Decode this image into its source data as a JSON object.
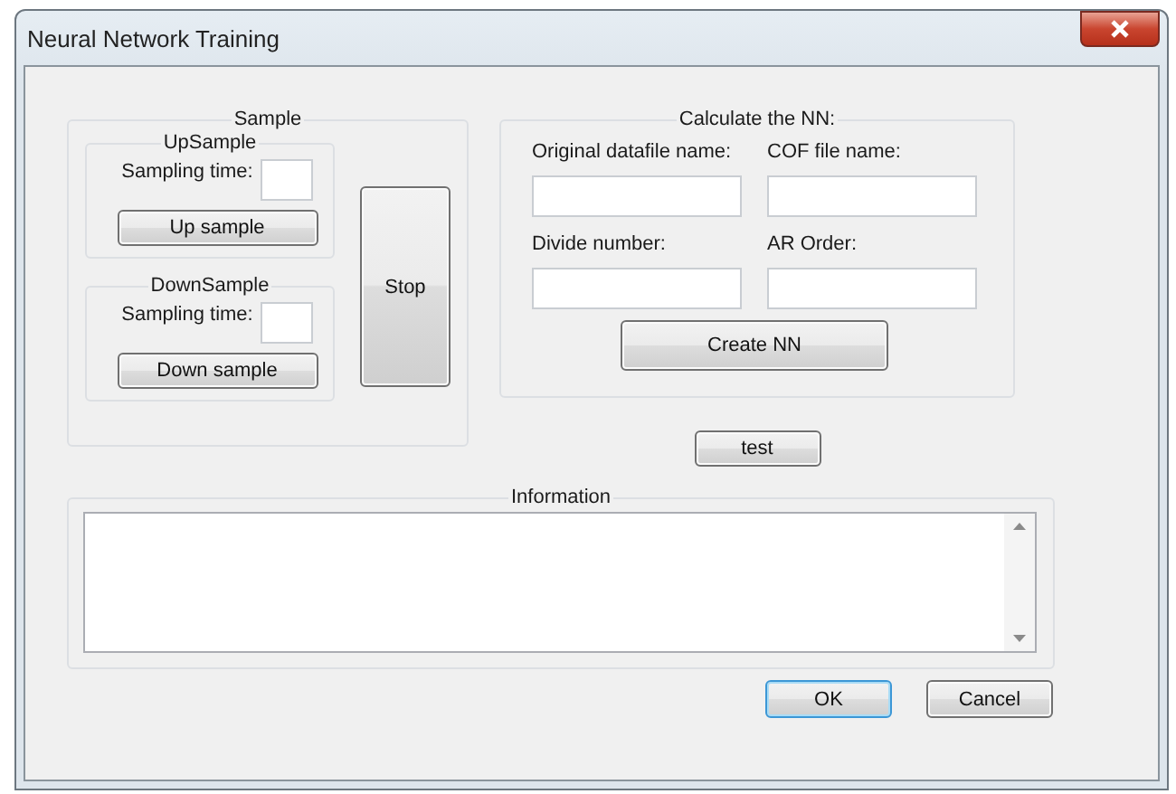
{
  "window": {
    "title": "Neural Network Training"
  },
  "sample": {
    "title": "Sample",
    "groups": [
      {
        "title": "UpSample",
        "label": "Sampling time:",
        "button": "Up sample"
      },
      {
        "title": "DownSample",
        "label": "Sampling time:",
        "button": "Down sample"
      }
    ],
    "stop_button": "Stop"
  },
  "calculate": {
    "title": "Calculate the NN:",
    "fields": [
      {
        "label": "Original datafile name:"
      },
      {
        "label": "COF file name:"
      },
      {
        "label": "Divide number:"
      },
      {
        "label": "AR Order:"
      }
    ],
    "button": "Create NN"
  },
  "test_button": "test",
  "information": {
    "title": "Information"
  },
  "buttons": [
    {
      "label": "OK",
      "default": true
    },
    {
      "label": "Cancel",
      "default": false
    }
  ]
}
